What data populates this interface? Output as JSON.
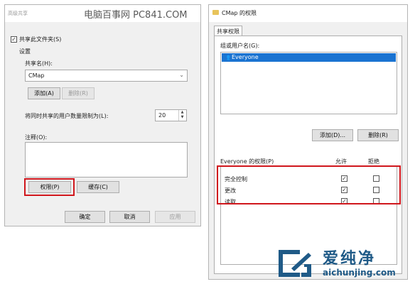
{
  "left_dialog": {
    "title": "高级共享",
    "share_checkbox_label": "共享此文件夹(S)",
    "settings_label": "设置",
    "share_name_label": "共享名(H):",
    "share_name_value": "CMap",
    "add_label": "添加(A)",
    "remove_label": "删除(R)",
    "limit_label": "将同时共享的用户数量限制为(L):",
    "limit_value": "20",
    "comments_label": "注释(O):",
    "permissions_label": "权限(P)",
    "cache_label": "缓存(C)",
    "ok_label": "确定",
    "cancel_label": "取消",
    "apply_label": "应用"
  },
  "watermark_top": "电脑百事网 PC841.COM",
  "right_dialog": {
    "title": "CMap 的权限",
    "tab_label": "共享权限",
    "group_label": "组或用户名(G):",
    "users": [
      "Everyone"
    ],
    "add_label": "添加(D)...",
    "remove_label": "删除(R)",
    "perm_header": "Everyone 的权限(P)",
    "allow_header": "允许",
    "deny_header": "拒绝",
    "permissions": [
      {
        "name": "完全控制",
        "allow": true,
        "deny": false
      },
      {
        "name": "更改",
        "allow": true,
        "deny": false
      },
      {
        "name": "读取",
        "allow": true,
        "deny": false
      }
    ]
  },
  "logo": {
    "name": "爱纯净",
    "url": "aichunjing.com",
    "color": "#1f5a87"
  }
}
